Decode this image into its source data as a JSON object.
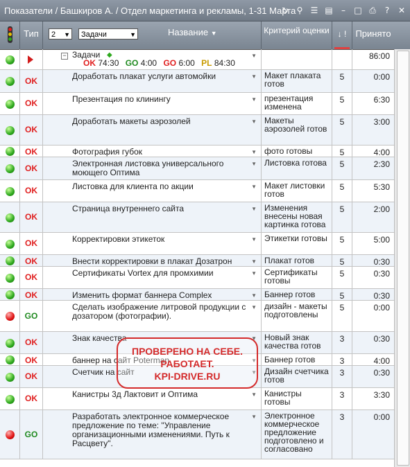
{
  "window": {
    "title": "Показатели / Башкиров А. / Отдел маркетинга и рекламы, 1-31 Марта"
  },
  "header": {
    "type_label": "Тип",
    "level_value": "2",
    "filter_value": "Задачи",
    "name_label": "Название",
    "criteria_label": "Критерий оценки",
    "priority_label": "↓ !",
    "accepted_label": "Принято"
  },
  "parent": {
    "title": "Задачи",
    "stats": [
      {
        "label": "OK",
        "value": "74:30",
        "color": "#e01e1e"
      },
      {
        "label": "GO",
        "value": "4:00",
        "color": "#1f8a1f"
      },
      {
        "label": "GO",
        "value": "6:00",
        "color": "#e01e1e"
      },
      {
        "label": "PL",
        "value": "84:30",
        "color": "#c89b00"
      }
    ],
    "accepted": "86:00"
  },
  "rows": [
    {
      "status": "green",
      "type": "OK",
      "name": "Доработать плакат услуги автомойки",
      "criteria": "Макет плаката готов",
      "priority": "5",
      "accepted": "0:00"
    },
    {
      "status": "green",
      "type": "OK",
      "name": "Презентация по клинингу",
      "criteria": "презентация изменена",
      "priority": "5",
      "accepted": "6:30"
    },
    {
      "status": "green",
      "type": "OK",
      "name": "Доработать макеты аэрозолей",
      "criteria": "Макеты аэрозолей готов",
      "priority": "5",
      "accepted": "3:00"
    },
    {
      "status": "green",
      "type": "OK",
      "name": "Фотография губок",
      "criteria": "фото готовы",
      "priority": "5",
      "accepted": "4:00"
    },
    {
      "status": "green",
      "type": "OK",
      "name": "Электронная листовка универсального моющего Оптима",
      "criteria": "Листовка готова",
      "priority": "5",
      "accepted": "2:30"
    },
    {
      "status": "green",
      "type": "OK",
      "name": "Листовка для клиента по акции",
      "criteria": "Макет листовки готов",
      "priority": "5",
      "accepted": "5:30"
    },
    {
      "status": "green",
      "type": "OK",
      "name": "Страница внутреннего сайта",
      "criteria": "Изменения внесены новая картинка готова",
      "priority": "5",
      "accepted": "2:00"
    },
    {
      "status": "green",
      "type": "OK",
      "name": "Корректировки этикеток",
      "criteria": "Этикетки готовы",
      "priority": "5",
      "accepted": "5:00"
    },
    {
      "status": "green",
      "type": "OK",
      "name": "Внести корректировки в плакат Дозатрон",
      "criteria": "Плакат готов",
      "priority": "5",
      "accepted": "0:30"
    },
    {
      "status": "green",
      "type": "OK",
      "name": "Сертификаты Vortex для промхимии",
      "criteria": "Сертификаты готовы",
      "priority": "5",
      "accepted": "0:30"
    },
    {
      "status": "green",
      "type": "OK",
      "name": "Изменить формат баннера Complex",
      "criteria": "Баннер готов",
      "priority": "5",
      "accepted": "0:30"
    },
    {
      "status": "red",
      "type": "GO",
      "name": "Сделать изображение литровой продукции с дозатором (фотографии).",
      "criteria": "дизайн - макеты подготовлены",
      "priority": "5",
      "accepted": "0:00"
    },
    {
      "status": "green",
      "type": "OK",
      "name": "Знак качества",
      "criteria": "Новый знак качества готов",
      "priority": "3",
      "accepted": "0:30"
    },
    {
      "status": "green",
      "type": "OK",
      "name": "баннер на сайт Poterman",
      "criteria": "Баннер готов",
      "priority": "3",
      "accepted": "4:00"
    },
    {
      "status": "green",
      "type": "OK",
      "name": "Счетчик на сайт",
      "criteria": "Дизайн счетчика готов",
      "priority": "3",
      "accepted": "0:30"
    },
    {
      "status": "green",
      "type": "OK",
      "name": "Канистры 3д Лактовит и Оптима",
      "criteria": "Канистры готовы",
      "priority": "3",
      "accepted": "3:30"
    },
    {
      "status": "red",
      "type": "GO",
      "name": "Разработать электронное коммерческое предложение по теме: \"Управление организационными изменениями. Путь к Расцвету\".",
      "criteria": "Электронное коммерческое предложение подготовлено и согласовано",
      "priority": "3",
      "accepted": "0:00"
    }
  ],
  "watermark": {
    "line1": "ПРОВЕРЕНО НА СЕБЕ.",
    "line2": "РАБОТАЕТ.",
    "line3": "KPI-DRIVE.RU"
  }
}
